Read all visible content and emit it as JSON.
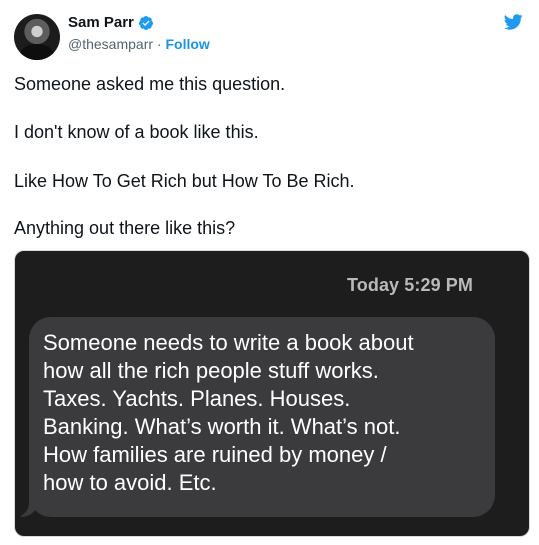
{
  "author": {
    "name": "Sam Parr",
    "handle": "@thesamparr",
    "separator": " · ",
    "follow_label": "Follow",
    "verified_icon": "verified-badge-icon",
    "avatar": "profile-photo"
  },
  "platform_icon": "twitter-bird-icon",
  "tweet": {
    "paragraphs": [
      "Someone asked me this question.",
      "I don't know of a book like this.",
      "Like How To Get Rich but How To Be Rich.",
      "Anything out there like this?"
    ]
  },
  "media": {
    "timestamp": "Today 5:29 PM",
    "message_lines": [
      "Someone needs to write a book about",
      "how all the rich people stuff works.",
      "Taxes. Yachts. Planes. Houses.",
      "Banking. What’s worth it. What’s not.",
      "How families are ruined by money /",
      "how to avoid. Etc."
    ]
  },
  "colors": {
    "accent": "#1b95e0",
    "text": "#0f1419",
    "secondary_text": "#536471",
    "media_bg": "#1d1d1d",
    "bubble_bg": "#3b3b3d"
  }
}
